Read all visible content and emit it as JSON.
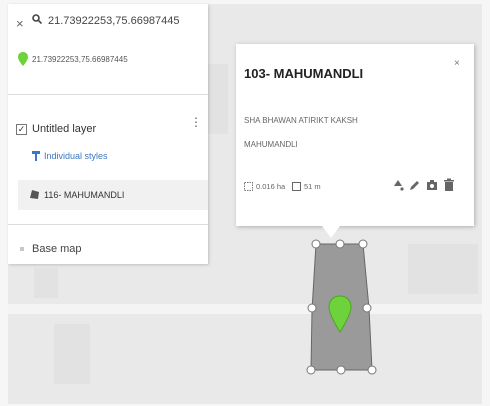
{
  "search": {
    "close_glyph": "×",
    "icon": "search-icon",
    "query": "21.73922253,75.66987445",
    "result_pin_icon": "location-pin-icon",
    "result_coords": "21.73922253,75.66987445"
  },
  "layer": {
    "checkbox_glyph": "✓",
    "title": "Untitled layer",
    "menu_glyph": "⋮",
    "styles_icon": "paint-roller-icon",
    "styles_label": "Individual styles",
    "feature_icon": "polygon-icon",
    "feature_label": "116- MAHUMANDLI"
  },
  "basemap": {
    "label": "Base map"
  },
  "popup": {
    "title": "103- MAHUMANDLI",
    "close_glyph": "×",
    "description_line1": "SHA BHAWAN ATIRIKT KAKSH",
    "description_line2": "MAHUMANDLI",
    "area_icon": "area-icon",
    "area_value": "0.016 ha",
    "length_icon": "length-icon",
    "length_value": "51 m",
    "actions": [
      "style-icon",
      "edit-icon",
      "camera-icon",
      "delete-icon"
    ]
  },
  "map": {
    "marker_color": "#6ed23c",
    "polygon_fill": "#9a9a9a"
  }
}
